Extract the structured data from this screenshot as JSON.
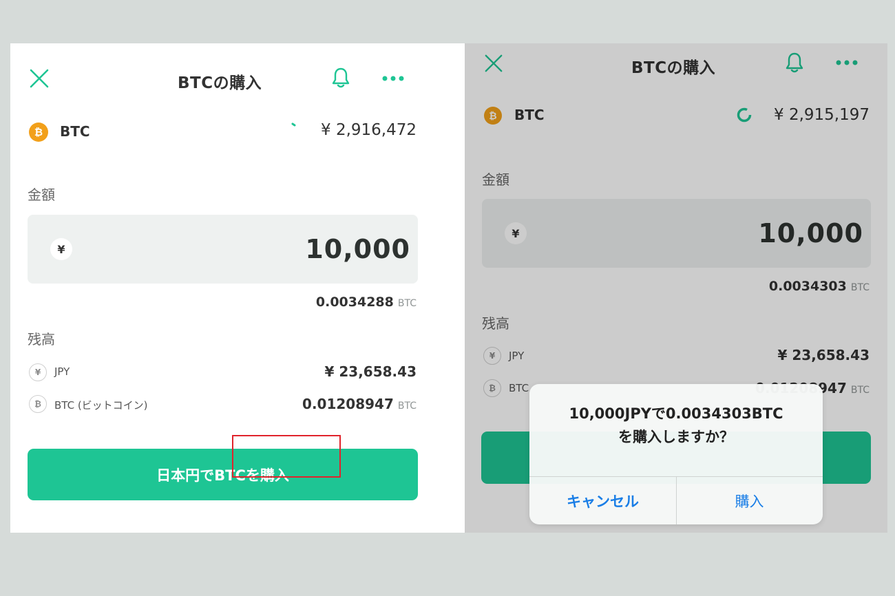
{
  "colors": {
    "accent": "#1ec594",
    "coin": "#f2a01a",
    "dialog_link": "#1a7ee6",
    "highlight": "#e0242c",
    "background": "#d6dbd9"
  },
  "left": {
    "header": {
      "title": "BTCの購入",
      "close_icon": "close-icon",
      "bell_icon": "bell-icon",
      "more_icon": "more-icon"
    },
    "asset": {
      "coin_symbol": "₿",
      "name": "BTC",
      "price": "¥ 2,916,472"
    },
    "amount": {
      "label": "金額",
      "currency_symbol": "¥",
      "value": "10,000",
      "converted": "0.0034288",
      "converted_unit": "BTC"
    },
    "balance": {
      "label": "残高",
      "items": [
        {
          "symbol": "¥",
          "name": "JPY",
          "value": "¥ 23,658.43",
          "unit": ""
        },
        {
          "symbol": "₿",
          "name": "BTC (ビットコイン)",
          "value": "0.01208947",
          "unit": "BTC"
        }
      ]
    },
    "buy_button": "日本円でBTCを購入"
  },
  "right": {
    "header": {
      "title": "BTCの購入",
      "close_icon": "close-icon",
      "bell_icon": "bell-icon",
      "more_icon": "more-icon"
    },
    "asset": {
      "coin_symbol": "₿",
      "name": "BTC",
      "price": "¥ 2,915,197"
    },
    "amount": {
      "label": "金額",
      "currency_symbol": "¥",
      "value": "10,000",
      "converted": "0.0034303",
      "converted_unit": "BTC"
    },
    "balance": {
      "label": "残高",
      "items": [
        {
          "symbol": "¥",
          "name": "JPY",
          "value": "¥ 23,658.43",
          "unit": ""
        },
        {
          "symbol": "₿",
          "name": "BTC",
          "value": "0.01208947",
          "unit": "BTC"
        }
      ]
    },
    "dialog": {
      "message_line1": "10,000JPYで0.0034303BTC",
      "message_line2": "を購入しますか？",
      "cancel": "キャンセル",
      "confirm": "購入"
    }
  }
}
